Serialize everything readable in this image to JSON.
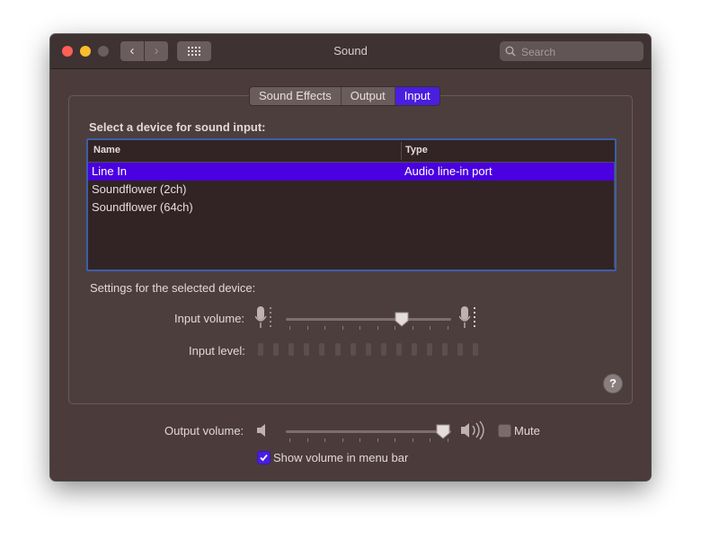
{
  "window": {
    "title": "Sound",
    "search_placeholder": "Search"
  },
  "tabs": [
    {
      "label": "Sound Effects",
      "active": false
    },
    {
      "label": "Output",
      "active": false
    },
    {
      "label": "Input",
      "active": true
    }
  ],
  "input_panel": {
    "heading": "Select a device for sound input:",
    "columns": [
      "Name",
      "Type"
    ],
    "devices": [
      {
        "name": "Line In",
        "type": "Audio line-in port",
        "selected": true
      },
      {
        "name": "Soundflower (2ch)",
        "type": "",
        "selected": false
      },
      {
        "name": "Soundflower (64ch)",
        "type": "",
        "selected": false
      }
    ],
    "settings_label": "Settings for the selected device:",
    "input_volume_label": "Input volume:",
    "input_volume_level": 0.7,
    "input_level_label": "Input level:",
    "input_level_segments": 15,
    "help_label": "?"
  },
  "output": {
    "volume_label": "Output volume:",
    "volume_level": 0.95,
    "mute_label": "Mute",
    "mute_checked": false,
    "show_in_menubar_label": "Show volume in menu bar",
    "show_in_menubar_checked": true
  },
  "colors": {
    "accent": "#4a00e0",
    "window_bg": "#4b3b3b"
  },
  "icons": [
    "search-icon",
    "back-chevron-icon",
    "forward-chevron-icon",
    "grid-icon",
    "microphone-low-icon",
    "microphone-high-icon",
    "speaker-low-icon",
    "speaker-high-icon",
    "help-icon",
    "checkmark-icon"
  ]
}
